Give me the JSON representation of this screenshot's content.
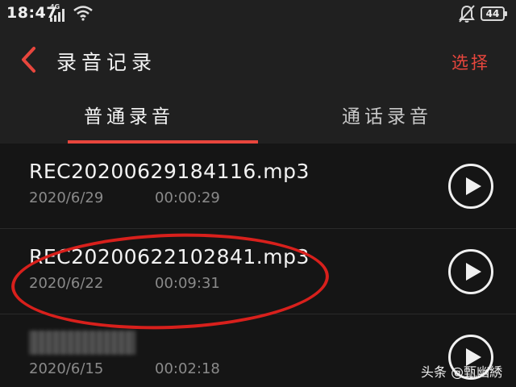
{
  "status_bar": {
    "time": "18:47",
    "network": "4G",
    "battery": "44"
  },
  "header": {
    "title": "录音记录",
    "select_label": "选择"
  },
  "tabs": [
    {
      "label": "普通录音",
      "active": true
    },
    {
      "label": "通话录音",
      "active": false
    }
  ],
  "recordings": [
    {
      "name": "REC20200629184116.mp3",
      "date": "2020/6/29",
      "duration": "00:00:29"
    },
    {
      "name": "REC20200622102841.mp3",
      "date": "2020/6/22",
      "duration": "00:09:31"
    },
    {
      "name": "",
      "date": "2020/6/15",
      "duration": "00:02:18"
    }
  ],
  "watermark": "头条 @甄幽綉",
  "colors": {
    "accent": "#e8463d",
    "annotation": "#d8201c",
    "background": "#151515",
    "bar_background": "#202020"
  }
}
